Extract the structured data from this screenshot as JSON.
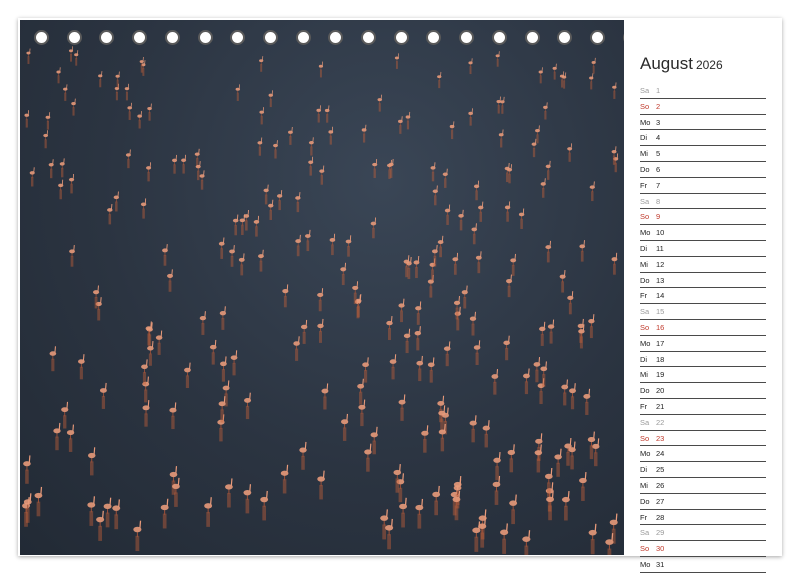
{
  "calendar": {
    "month": "August",
    "year": "2026",
    "days": [
      {
        "wd": "Sa",
        "num": "1",
        "type": "sat"
      },
      {
        "wd": "So",
        "num": "2",
        "type": "sun"
      },
      {
        "wd": "Mo",
        "num": "3",
        "type": "wk"
      },
      {
        "wd": "Di",
        "num": "4",
        "type": "wk"
      },
      {
        "wd": "Mi",
        "num": "5",
        "type": "wk"
      },
      {
        "wd": "Do",
        "num": "6",
        "type": "wk"
      },
      {
        "wd": "Fr",
        "num": "7",
        "type": "wk"
      },
      {
        "wd": "Sa",
        "num": "8",
        "type": "sat"
      },
      {
        "wd": "So",
        "num": "9",
        "type": "sun"
      },
      {
        "wd": "Mo",
        "num": "10",
        "type": "wk"
      },
      {
        "wd": "Di",
        "num": "11",
        "type": "wk"
      },
      {
        "wd": "Mi",
        "num": "12",
        "type": "wk"
      },
      {
        "wd": "Do",
        "num": "13",
        "type": "wk"
      },
      {
        "wd": "Fr",
        "num": "14",
        "type": "wk"
      },
      {
        "wd": "Sa",
        "num": "15",
        "type": "sat"
      },
      {
        "wd": "So",
        "num": "16",
        "type": "sun"
      },
      {
        "wd": "Mo",
        "num": "17",
        "type": "wk"
      },
      {
        "wd": "Di",
        "num": "18",
        "type": "wk"
      },
      {
        "wd": "Mi",
        "num": "19",
        "type": "wk"
      },
      {
        "wd": "Do",
        "num": "20",
        "type": "wk"
      },
      {
        "wd": "Fr",
        "num": "21",
        "type": "wk"
      },
      {
        "wd": "Sa",
        "num": "22",
        "type": "sat"
      },
      {
        "wd": "So",
        "num": "23",
        "type": "sun"
      },
      {
        "wd": "Mo",
        "num": "24",
        "type": "wk"
      },
      {
        "wd": "Di",
        "num": "25",
        "type": "wk"
      },
      {
        "wd": "Mi",
        "num": "26",
        "type": "wk"
      },
      {
        "wd": "Do",
        "num": "27",
        "type": "wk"
      },
      {
        "wd": "Fr",
        "num": "28",
        "type": "wk"
      },
      {
        "wd": "Sa",
        "num": "29",
        "type": "sat"
      },
      {
        "wd": "So",
        "num": "30",
        "type": "sun"
      },
      {
        "wd": "Mo",
        "num": "31",
        "type": "wk"
      }
    ]
  },
  "colors": {
    "water": "#2b3441",
    "flamingo": "#e89a7a",
    "reflection": "#c2603a",
    "sunday": "#c0392b",
    "saturday": "#9a9a9a"
  },
  "icons": {
    "binding": "spiral-binding-ring"
  }
}
